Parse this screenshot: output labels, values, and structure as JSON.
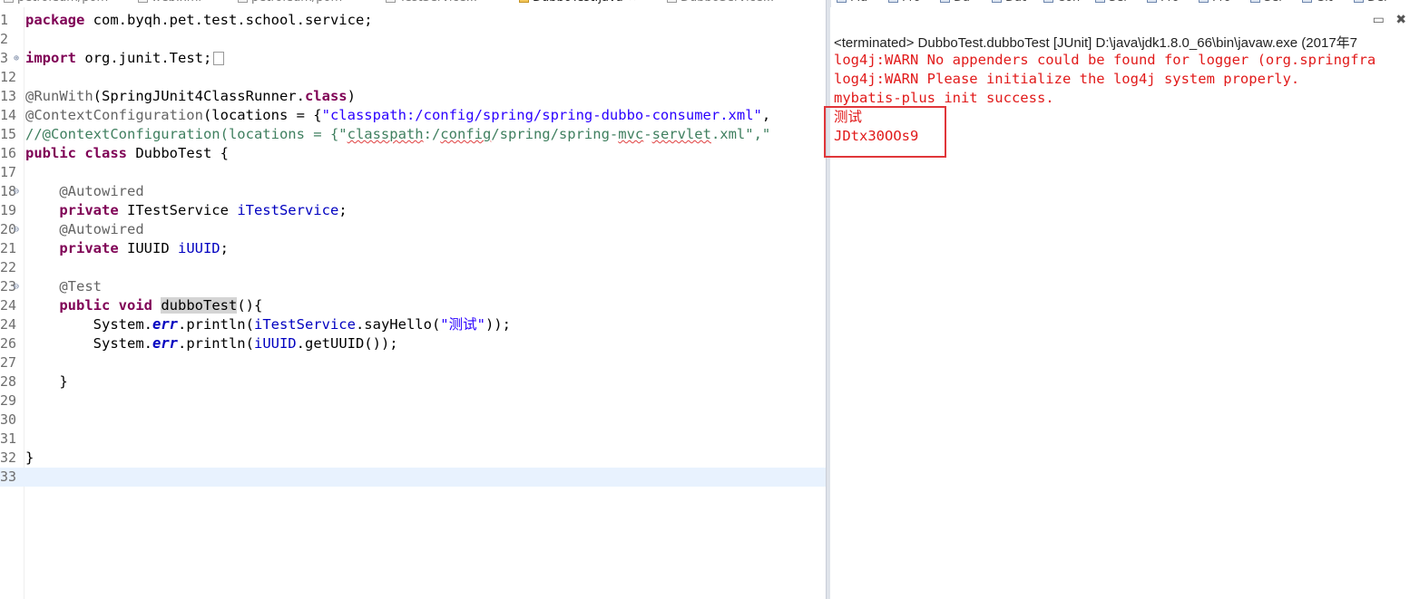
{
  "tabs": {
    "left": [
      "petroleum/pom",
      "web.xml",
      "petroleum/pom",
      "TestService..."
    ],
    "active": "DubboTest.java",
    "after": [
      "DubboService..."
    ],
    "right": [
      "Ma",
      "Pro",
      "Da",
      "Dat",
      "Con",
      "Ser",
      "Pro",
      "Pro",
      "Ser",
      "Git",
      "Del"
    ]
  },
  "editor": {
    "lines": [
      {
        "n": "1",
        "html": "<span class='kw'>package</span> com.byqh.pet.test.school.service;"
      },
      {
        "n": "2",
        "html": ""
      },
      {
        "n": "3",
        "fold": "⊕",
        "html": "<span class='kw'>import</span> org.junit.Test;<span class='collapsed-box'></span>"
      },
      {
        "n": "12",
        "html": ""
      },
      {
        "n": "13",
        "html": "<span class='ann'>@RunWith</span>(SpringJUnit4ClassRunner.<span class='kw'>class</span>)"
      },
      {
        "n": "14",
        "html": "<span class='ann'>@ContextConfiguration</span>(locations = {<span class='str'>\"classpath:/config/spring/spring-dubbo-consumer.xml\"</span>,"
      },
      {
        "n": "15",
        "html": "<span class='cmt'>//@ContextConfiguration(locations = {\"<span class='squig'>classpath</span>:/<span class='squig'>config</span>/spring/spring-<span class='squig'>mvc</span>-<span class='squig'>servlet</span>.xml\",\"</span>"
      },
      {
        "n": "16",
        "html": "<span class='kw'>public</span> <span class='kw'>class</span> DubboTest {"
      },
      {
        "n": "17",
        "html": ""
      },
      {
        "n": "18",
        "fold": "⊖",
        "html": "    <span class='ann'>@Autowired</span>"
      },
      {
        "n": "19",
        "html": "    <span class='kw'>private</span> ITestService <span class='fld'>iTestService</span>;"
      },
      {
        "n": "20",
        "fold": "⊖",
        "html": "    <span class='ann'>@Autowired</span>"
      },
      {
        "n": "21",
        "html": "    <span class='kw'>private</span> IUUID <span class='fld'>iUUID</span>;"
      },
      {
        "n": "22",
        "html": ""
      },
      {
        "n": "23",
        "fold": "⊖",
        "html": "    <span class='ann'>@Test</span>"
      },
      {
        "n": "24",
        "html": "    <span class='kw'>public</span> <span class='kw'>void</span> <span class='hl'>dubboTest</span>(){"
      },
      {
        "n": "24",
        "html": "        System.<span class='sfld'>err</span>.println(<span class='fld'>iTestService</span>.sayHello(<span class='str'>\"测试\"</span>));"
      },
      {
        "n": "26",
        "html": "        System.<span class='sfld'>err</span>.println(<span class='fld'>iUUID</span>.getUUID());"
      },
      {
        "n": "27",
        "html": ""
      },
      {
        "n": "28",
        "html": "    }"
      },
      {
        "n": "29",
        "html": ""
      },
      {
        "n": "30",
        "html": ""
      },
      {
        "n": "31",
        "html": ""
      },
      {
        "n": "32",
        "html": "}"
      },
      {
        "n": "33",
        "html": "",
        "current": true
      }
    ]
  },
  "console": {
    "terminated": "<terminated> DubboTest.dubboTest [JUnit] D:\\java\\jdk1.8.0_66\\bin\\javaw.exe (2017年7",
    "output": [
      "log4j:WARN No appenders could be found for logger (org.springfra",
      "log4j:WARN Please initialize the log4j system properly.",
      "mybatis-plus init success.",
      "测试",
      "JDtx30OOs9"
    ],
    "tools": {
      "minimize": "▭",
      "close": "✖"
    }
  },
  "colors": {
    "highlight_box": "#e0363a",
    "output_text": "#e11a1a"
  }
}
